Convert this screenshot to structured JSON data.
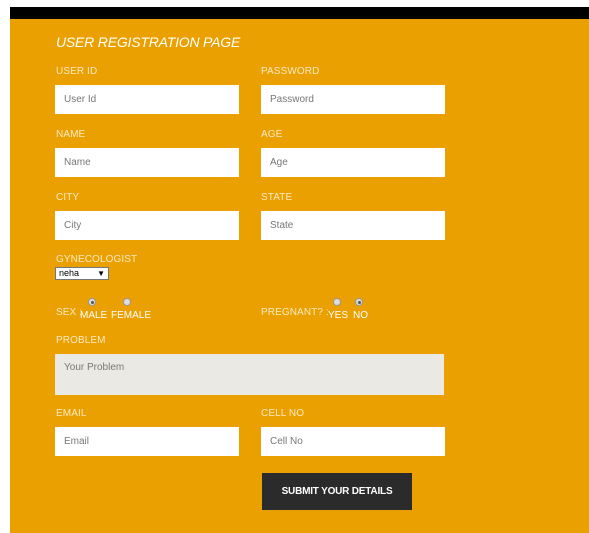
{
  "page": {
    "title": "USER REGISTRATION PAGE",
    "accent_color": "#e9a000",
    "submit_bg": "#2b2b2b"
  },
  "form": {
    "user_id": {
      "label": "USER ID",
      "placeholder": "User Id"
    },
    "password": {
      "label": "PASSWORD",
      "placeholder": "Password"
    },
    "name": {
      "label": "NAME",
      "placeholder": "Name"
    },
    "age": {
      "label": "AGE",
      "placeholder": "Age"
    },
    "city": {
      "label": "CITY",
      "placeholder": "City"
    },
    "state": {
      "label": "STATE",
      "placeholder": "State"
    },
    "gynecologist": {
      "label": "GYNECOLOGIST",
      "selected": "neha"
    },
    "sex": {
      "label": "SEX :",
      "options": [
        "MALE",
        "FEMALE"
      ],
      "selected": "MALE"
    },
    "pregnant": {
      "label": "PREGNANT? :",
      "options": [
        "YES",
        "NO"
      ],
      "selected": "NO"
    },
    "problem": {
      "label": "PROBLEM",
      "placeholder": "Your Problem"
    },
    "email": {
      "label": "EMAIL",
      "placeholder": "Email"
    },
    "cell_no": {
      "label": "CELL NO",
      "placeholder": "Cell No"
    },
    "submit_label": "SUBMIT YOUR DETAILS"
  }
}
